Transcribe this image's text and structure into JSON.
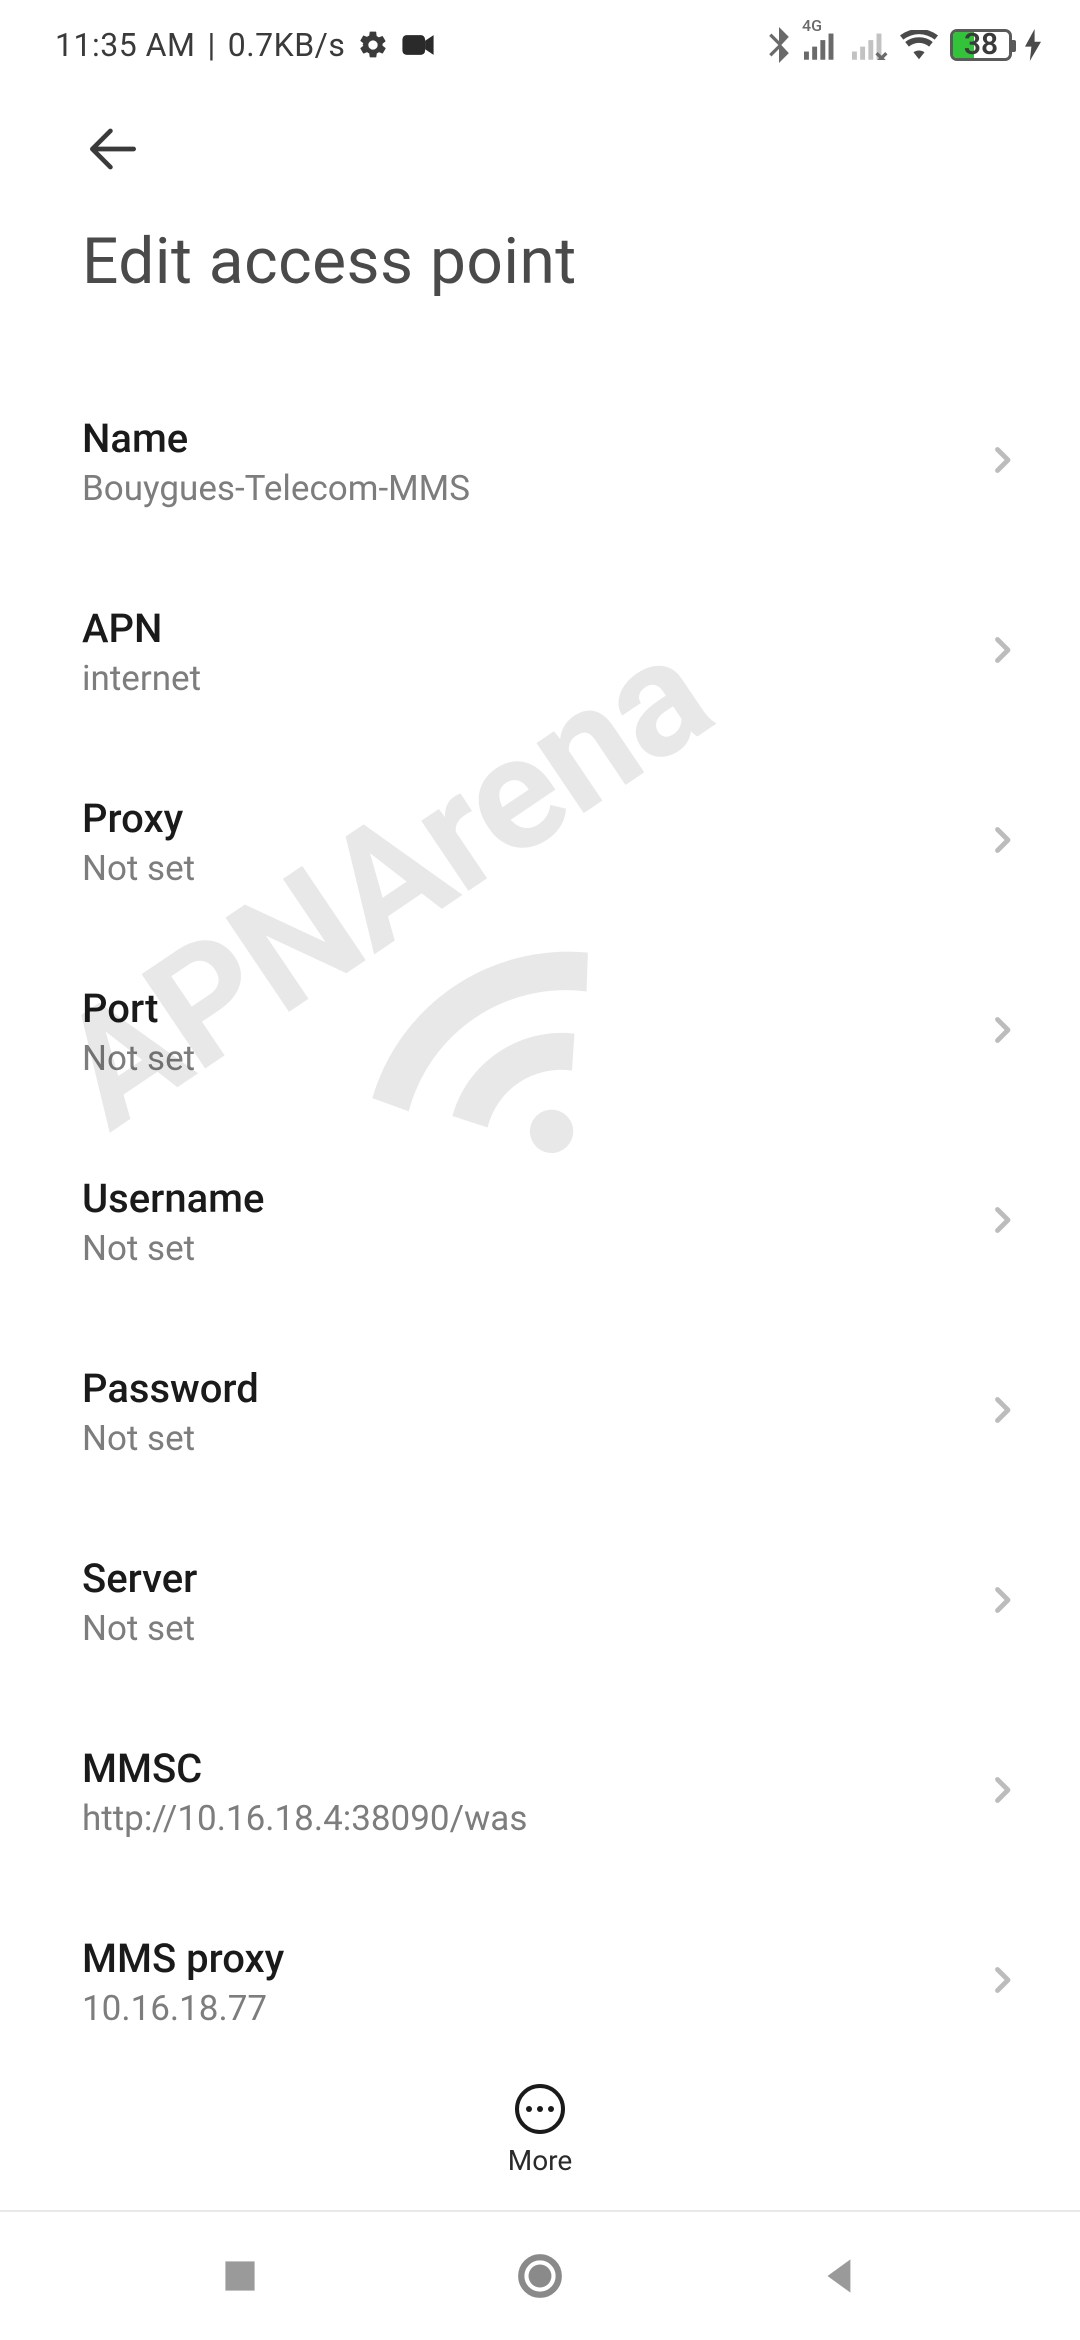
{
  "status_bar": {
    "time": "11:35 AM",
    "separator": "|",
    "data_rate": "0.7KB/s",
    "network_label": "4G",
    "battery_percent": "38",
    "icons": {
      "settings": "gear-icon",
      "camera": "camera-icon",
      "bluetooth": "bluetooth-icon",
      "signal_primary": "signal-4g-icon",
      "signal_secondary": "signal-nosim-icon",
      "wifi": "wifi-icon",
      "battery": "battery-icon",
      "charging": "charging-bolt-icon"
    }
  },
  "header": {
    "page_title": "Edit access point"
  },
  "fields": [
    {
      "id": "name",
      "label": "Name",
      "value": "Bouygues-Telecom-MMS"
    },
    {
      "id": "apn",
      "label": "APN",
      "value": "internet"
    },
    {
      "id": "proxy",
      "label": "Proxy",
      "value": "Not set"
    },
    {
      "id": "port",
      "label": "Port",
      "value": "Not set"
    },
    {
      "id": "username",
      "label": "Username",
      "value": "Not set"
    },
    {
      "id": "password",
      "label": "Password",
      "value": "Not set"
    },
    {
      "id": "server",
      "label": "Server",
      "value": "Not set"
    },
    {
      "id": "mmsc",
      "label": "MMSC",
      "value": "http://10.16.18.4:38090/was"
    },
    {
      "id": "mms_proxy",
      "label": "MMS proxy",
      "value": "10.16.18.77"
    }
  ],
  "bottom_action": {
    "more_label": "More"
  },
  "watermark": {
    "text": "APNArena"
  }
}
